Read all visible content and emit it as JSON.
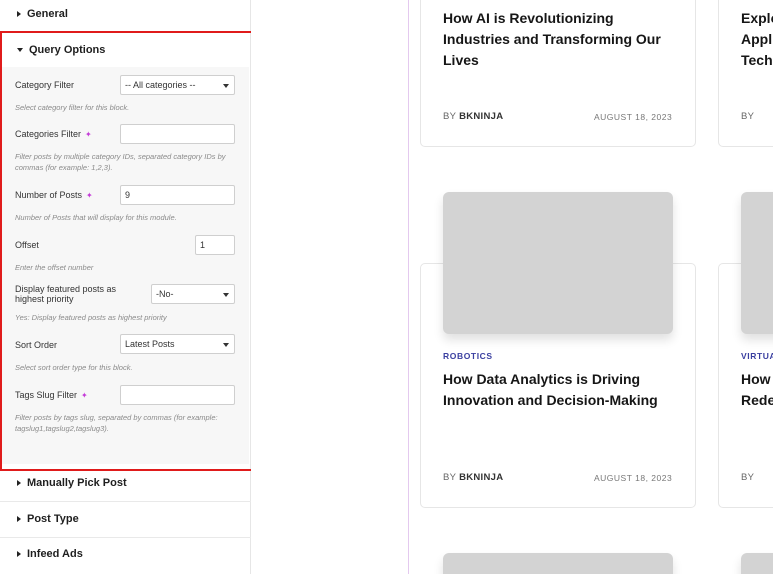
{
  "sections": {
    "general": "General",
    "query_options": "Query Options",
    "manually_pick_post": "Manually Pick Post",
    "post_type": "Post Type",
    "infeed_ads": "Infeed Ads"
  },
  "query": {
    "category_filter": {
      "label": "Category Filter",
      "value": "-- All categories --",
      "hint": "Select category filter for this block."
    },
    "categories_filter": {
      "label": "Categories Filter",
      "value": "",
      "hint": "Filter posts by multiple category IDs, separated category IDs by commas (for example: 1,2,3)."
    },
    "number_of_posts": {
      "label": "Number of Posts",
      "value": "9",
      "hint": "Number of Posts that will display for this module."
    },
    "offset": {
      "label": "Offset",
      "value": "1",
      "hint": "Enter the offset number"
    },
    "featured": {
      "label": "Display featured posts as highest priority",
      "value": "-No-",
      "hint": "Yes: Display featured posts as highest priority"
    },
    "sort_order": {
      "label": "Sort Order",
      "value": "Latest Posts",
      "hint": "Select sort order type for this block."
    },
    "tags_slug": {
      "label": "Tags Slug Filter",
      "value": "",
      "hint": "Filter posts by tags slug, separated by commas (for example: tagslug1,tagslug2,tagslug3)."
    }
  },
  "posts": [
    {
      "title_lines": [
        "How AI is Revolutionizing",
        "Industries and Transforming Our",
        "Lives"
      ],
      "by": "BY",
      "author": "BKNINJA",
      "date": "AUGUST 18, 2023"
    },
    {
      "title_lines": [
        "Explo",
        "Appli",
        "Tech"
      ],
      "by": "BY"
    },
    {
      "category": "ROBOTICS",
      "title_lines": [
        "How Data Analytics is Driving",
        "Innovation and Decision-Making"
      ],
      "by": "BY",
      "author": "BKNINJA",
      "date": "AUGUST 18, 2023"
    },
    {
      "category": "VIRTUA",
      "title_lines": [
        "How",
        "Rede"
      ],
      "by": "BY"
    }
  ],
  "icons": {
    "ai": "sparkle-icon",
    "collapsed": "caret-right-icon",
    "expanded": "caret-down-icon"
  },
  "colors": {
    "highlight_border": "#e01b1b",
    "category_text": "#3a3fa0",
    "ai_icon": "#c43bd8",
    "thumbnail": "#d3d3d3"
  }
}
